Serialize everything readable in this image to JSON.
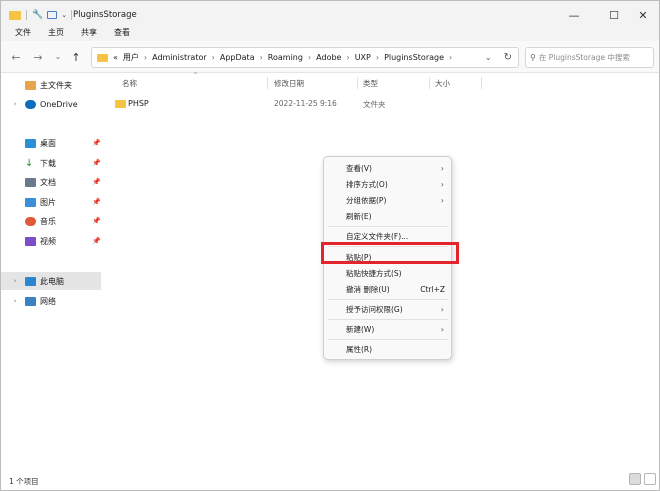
{
  "window": {
    "title": "PluginsStorage",
    "controls": {
      "minimize": "—",
      "maximize": "☐",
      "close": "✕"
    }
  },
  "ribbon": {
    "items": [
      "文件",
      "主页",
      "共享",
      "查看"
    ]
  },
  "nav": {
    "back": "←",
    "forward": "→",
    "recent": "⌄",
    "up": "↑",
    "overflow": "«",
    "breadcrumbs": [
      "用户",
      "Administrator",
      "AppData",
      "Roaming",
      "Adobe",
      "UXP",
      "PluginsStorage"
    ],
    "dropdown": "⌄",
    "refresh": "↻"
  },
  "search": {
    "placeholder": "在 PluginsStorage 中搜索"
  },
  "sidebar": {
    "items": [
      {
        "label": "主文件夹",
        "icon": "home-icon"
      },
      {
        "label": "OneDrive",
        "icon": "cloud-icon"
      },
      {
        "label": "桌面",
        "icon": "desktop-icon"
      },
      {
        "label": "下载",
        "icon": "download-icon"
      },
      {
        "label": "文档",
        "icon": "document-icon"
      },
      {
        "label": "图片",
        "icon": "picture-icon"
      },
      {
        "label": "音乐",
        "icon": "music-icon"
      },
      {
        "label": "视频",
        "icon": "video-icon"
      },
      {
        "label": "此电脑",
        "icon": "computer-icon"
      },
      {
        "label": "网络",
        "icon": "network-icon"
      }
    ]
  },
  "columns": {
    "name": "名称",
    "modified": "修改日期",
    "type": "类型",
    "size": "大小"
  },
  "files": [
    {
      "name": "PHSP",
      "modified": "2022-11-25 9:16",
      "type": "文件夹",
      "size": ""
    }
  ],
  "context_menu": {
    "items": [
      {
        "label": "查看(V)",
        "submenu": true
      },
      {
        "label": "排序方式(O)",
        "submenu": true
      },
      {
        "label": "分组依据(P)",
        "submenu": true
      },
      {
        "label": "刷新(E)"
      },
      {
        "label": "自定义文件夹(F)..."
      },
      {
        "label": "粘贴(P)"
      },
      {
        "label": "粘贴快捷方式(S)"
      },
      {
        "label": "撤消 删除(U)",
        "shortcut": "Ctrl+Z"
      },
      {
        "label": "授予访问权限(G)",
        "submenu": true
      },
      {
        "label": "新建(W)",
        "submenu": true
      },
      {
        "label": "属性(R)"
      }
    ]
  },
  "status": {
    "count": "1 个项目"
  },
  "colors": {
    "accent": "#0067c0",
    "highlight": "#e3242b",
    "folder": "#f6c445"
  }
}
